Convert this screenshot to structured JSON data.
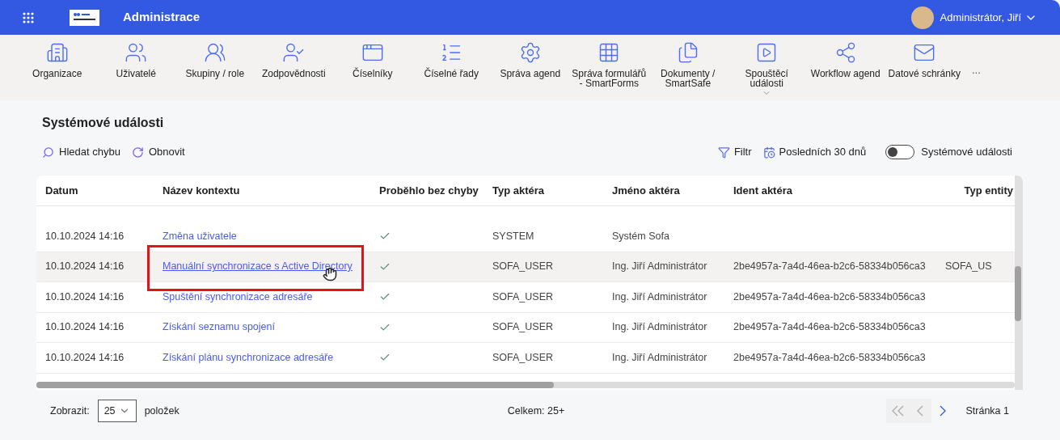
{
  "header": {
    "title": "Administrace",
    "user": "Administrátor, Jiří"
  },
  "toolbar": {
    "items": [
      {
        "label": "Organizace",
        "has_menu": false
      },
      {
        "label": "Uživatelé",
        "has_menu": false
      },
      {
        "label": "Skupiny / role",
        "has_menu": false
      },
      {
        "label": "Zodpovědnosti",
        "has_menu": false
      },
      {
        "label": "Číselníky",
        "has_menu": false
      },
      {
        "label": "Číselné řady",
        "has_menu": false
      },
      {
        "label": "Správa agend",
        "has_menu": false
      },
      {
        "label": "Správa formulářů - SmartForms",
        "has_menu": false
      },
      {
        "label": "Dokumenty / SmartSafe",
        "has_menu": false
      },
      {
        "label": "Spouštěcí události",
        "has_menu": true
      },
      {
        "label": "Workflow agend",
        "has_menu": false
      },
      {
        "label": "Datové schránky",
        "has_menu": false
      }
    ],
    "more": "..."
  },
  "page_title": "Systémové události",
  "actions": {
    "search": "Hledat chybu",
    "refresh": "Obnovit",
    "filter": "Filtr",
    "period": "Posledních 30 dnů",
    "toggle": {
      "label": "Systémové události",
      "on": false
    }
  },
  "table": {
    "columns": [
      "Datum",
      "Název kontextu",
      "Proběhlo bez chyby",
      "Typ aktéra",
      "Jméno aktéra",
      "Ident aktéra",
      "Typ entity"
    ],
    "rows": [
      {
        "date": "10.10.2024 14:16",
        "context": "Změna uživatele",
        "ok": true,
        "actor_type": "SYSTEM",
        "actor_name": "Systém Sofa",
        "actor_id": "",
        "entity_type": "",
        "selected": false
      },
      {
        "date": "10.10.2024 14:16",
        "context": "Manuální synchronizace s Active Directory",
        "ok": true,
        "actor_type": "SOFA_USER",
        "actor_name": "Ing. Jiří Administrátor",
        "actor_id": "2be4957a-7a4d-46ea-b2c6-58334b056ca3",
        "entity_type": "SOFA_US",
        "selected": true
      },
      {
        "date": "10.10.2024 14:16",
        "context": "Spuštění synchronizace adresáře",
        "ok": true,
        "actor_type": "SOFA_USER",
        "actor_name": "Ing. Jiří Administrátor",
        "actor_id": "2be4957a-7a4d-46ea-b2c6-58334b056ca3",
        "entity_type": "",
        "selected": false
      },
      {
        "date": "10.10.2024 14:16",
        "context": "Získání seznamu spojení",
        "ok": true,
        "actor_type": "SOFA_USER",
        "actor_name": "Ing. Jiří Administrátor",
        "actor_id": "2be4957a-7a4d-46ea-b2c6-58334b056ca3",
        "entity_type": "",
        "selected": false
      },
      {
        "date": "10.10.2024 14:16",
        "context": "Získání plánu synchronizace adresáře",
        "ok": true,
        "actor_type": "SOFA_USER",
        "actor_name": "Ing. Jiří Administrátor",
        "actor_id": "2be4957a-7a4d-46ea-b2c6-58334b056ca3",
        "entity_type": "",
        "selected": false
      }
    ]
  },
  "footer": {
    "show_label": "Zobrazit:",
    "page_size": "25",
    "items_label": "položek",
    "total": "Celkem: 25+",
    "first_disabled": true,
    "prev_disabled": true,
    "next_disabled": false,
    "page": "Stránka 1"
  }
}
